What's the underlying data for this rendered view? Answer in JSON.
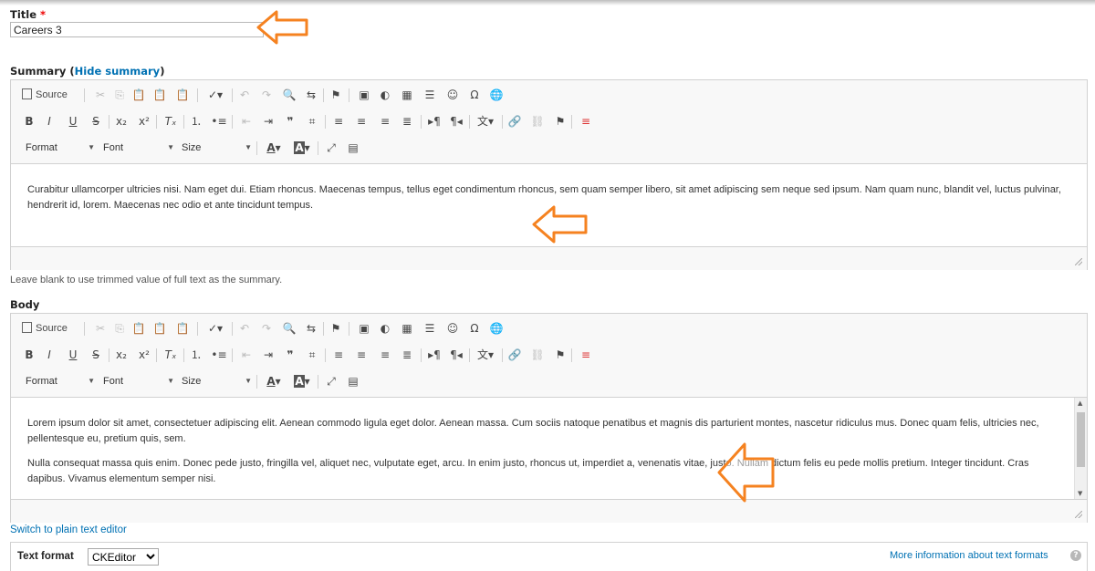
{
  "title_field": {
    "label": "Title",
    "required_mark": "*",
    "value": "Careers 3"
  },
  "summary": {
    "label": "Summary",
    "paren_open": "(",
    "toggle_link": "Hide summary",
    "paren_close": ")",
    "content": [
      "Curabitur ullamcorper ultricies nisi. Nam eget dui. Etiam rhoncus. Maecenas tempus, tellus eget condimentum rhoncus, sem quam semper libero, sit amet adipiscing sem neque sed ipsum. Nam quam nunc, blandit vel, luctus pulvinar, hendrerit id, lorem. Maecenas nec odio et ante tincidunt tempus."
    ],
    "help": "Leave blank to use trimmed value of full text as the summary."
  },
  "body": {
    "label": "Body",
    "content": [
      "Lorem ipsum dolor sit amet, consectetuer adipiscing elit. Aenean commodo ligula eget dolor. Aenean massa. Cum sociis natoque penatibus et magnis dis parturient montes, nascetur ridiculus mus. Donec quam felis, ultricies nec, pellentesque eu, pretium quis, sem.",
      "Nulla consequat massa quis enim. Donec pede justo, fringilla vel, aliquet nec, vulputate eget, arcu. In enim justo, rhoncus ut, imperdiet a, venenatis vitae, justo. Nullam dictum felis eu pede mollis pretium. Integer tincidunt. Cras dapibus. Vivamus elementum semper nisi."
    ],
    "switch_link": "Switch to plain text editor"
  },
  "toolbar": {
    "source_label": "Source",
    "format_label": "Format",
    "font_label": "Font",
    "size_label": "Size",
    "bold": "B",
    "italic": "I",
    "underline": "U",
    "strike": "S"
  },
  "text_format": {
    "label": "Text format",
    "selected": "CKEditor",
    "more_info": "More information about text formats",
    "help_icon": "?"
  },
  "annotation_color": "#f58220"
}
